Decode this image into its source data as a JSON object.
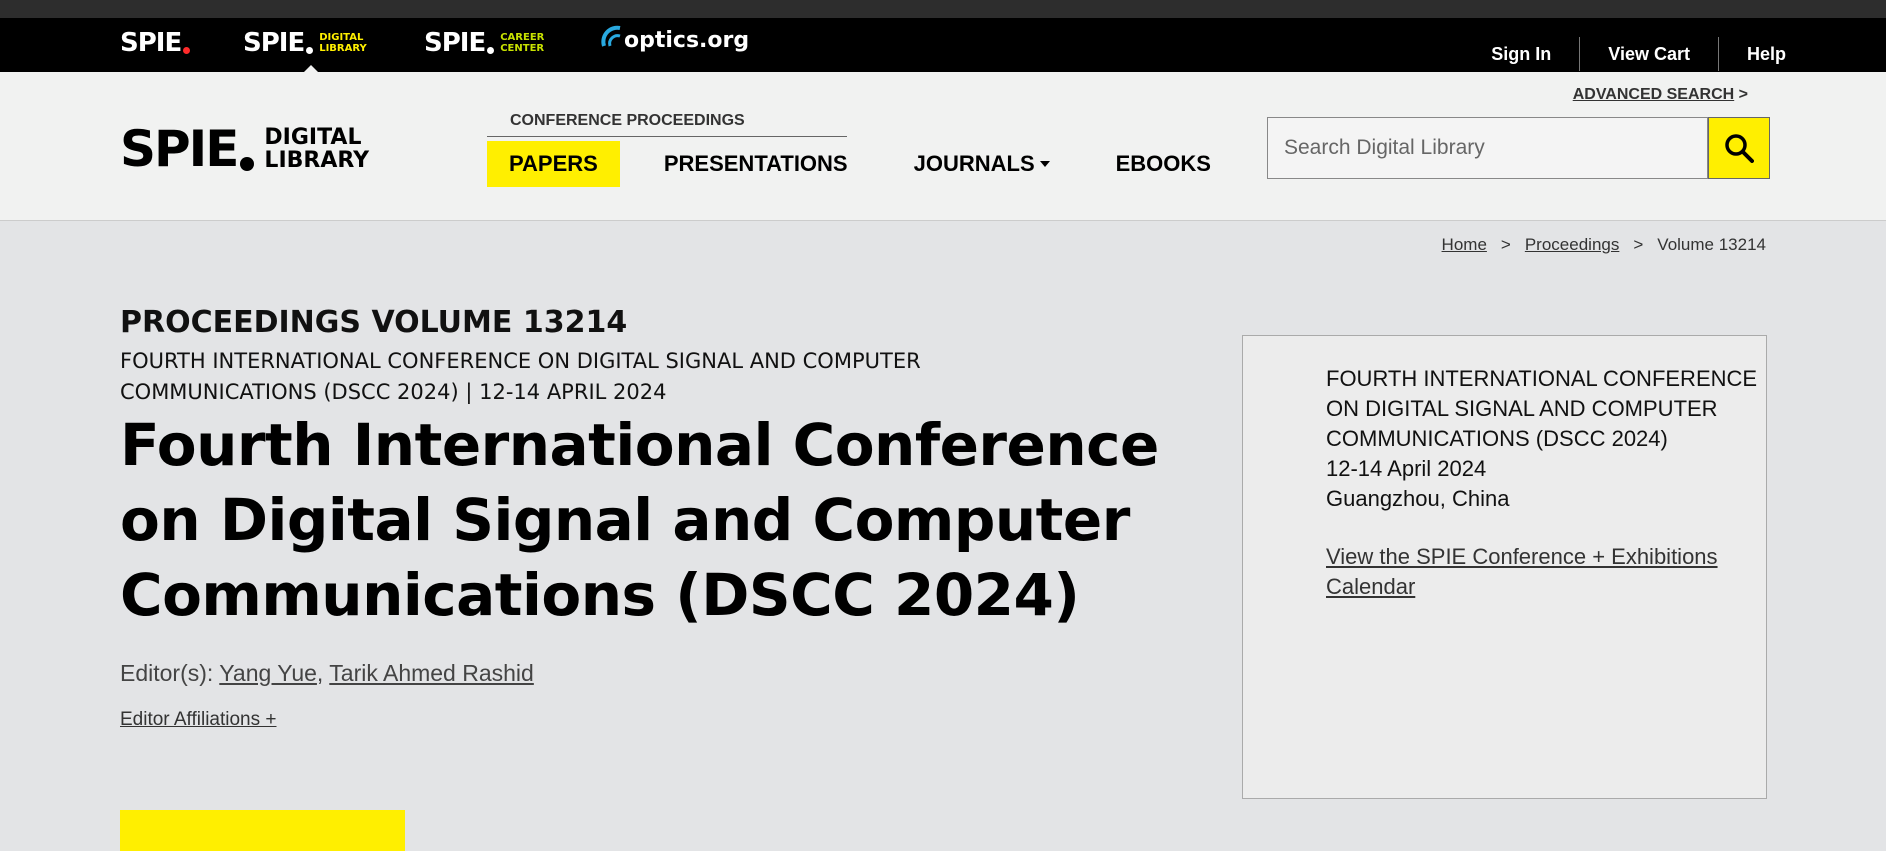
{
  "topbar": {
    "brands": [
      {
        "name": "SPIE",
        "sub1": "",
        "sub2": "",
        "color": "#ff2a2a"
      },
      {
        "name": "SPIE",
        "sub1": "DIGITAL",
        "sub2": "LIBRARY",
        "color": "#ffef00"
      },
      {
        "name": "SPIE",
        "sub1": "CAREER",
        "sub2": "CENTER",
        "color": "#c8e200"
      }
    ],
    "optics_label": "optics.org",
    "links": [
      "Sign In",
      "View Cart",
      "Help"
    ]
  },
  "header": {
    "logo_spie": "SPIE",
    "logo_sub1": "DIGITAL",
    "logo_sub2": "LIBRARY",
    "conference_proceedings": "CONFERENCE PROCEEDINGS",
    "nav": [
      "PAPERS",
      "PRESENTATIONS",
      "JOURNALS",
      "EBOOKS"
    ],
    "advanced_search": "ADVANCED SEARCH",
    "advanced_search_arrow": ">",
    "search_placeholder": "Search Digital Library"
  },
  "breadcrumb": {
    "home": "Home",
    "sep": ">",
    "proceedings": "Proceedings",
    "current": "Volume 13214"
  },
  "main": {
    "volume": "PROCEEDINGS VOLUME 13214",
    "conference_subtitle": "FOURTH INTERNATIONAL CONFERENCE ON DIGITAL SIGNAL AND COMPUTER COMMUNICATIONS (DSCC 2024) | 12-14 APRIL 2024",
    "title": "Fourth International Conference on Digital Signal and Computer Communications (DSCC 2024)",
    "editors_label": "Editor(s):",
    "editor1": "Yang Yue",
    "editor_sep": ",",
    "editor2": "Tarik Ahmed Rashid",
    "affiliations": "Editor Affiliations +"
  },
  "infobox": {
    "conference": "FOURTH INTERNATIONAL CONFERENCE ON DIGITAL SIGNAL AND COMPUTER COMMUNICATIONS (DSCC 2024)",
    "dates": "12-14 April 2024",
    "location": "Guangzhou, China",
    "calendar_link": "View the SPIE Conference + Exhibitions Calendar"
  },
  "colors": {
    "accent_yellow": "#ffef00",
    "topbar_bg": "#000000",
    "header_bg": "#f1f2f1",
    "page_bg": "#e3e4e6"
  }
}
